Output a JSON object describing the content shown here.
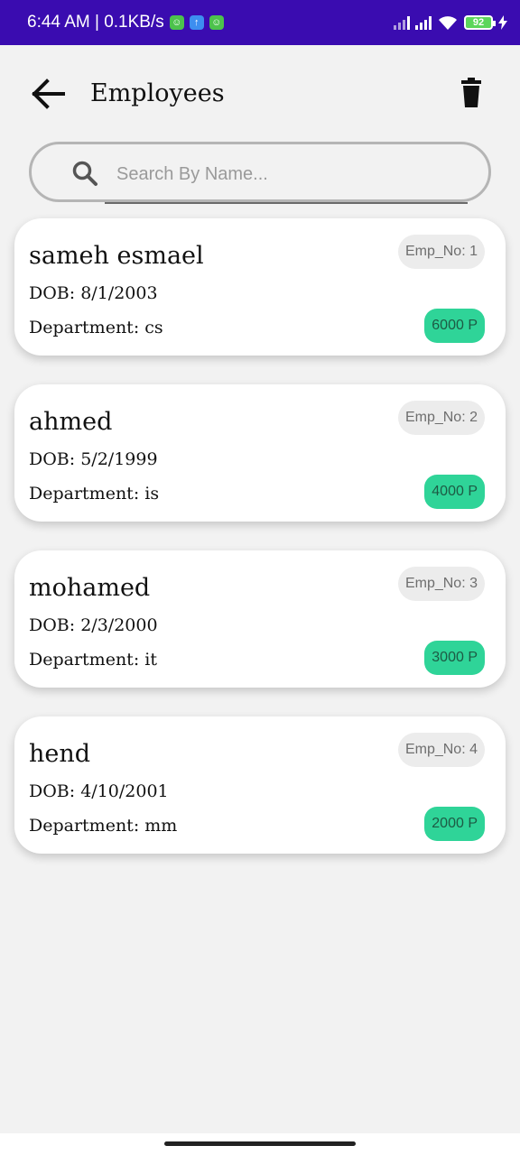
{
  "status_bar": {
    "time_speed": "6:44 AM | 0.1KB/s",
    "battery": "92"
  },
  "app_bar": {
    "title": "Employees"
  },
  "search": {
    "placeholder": "Search By Name..."
  },
  "employees": [
    {
      "name": "sameh esmael",
      "dob": "DOB: 8/1/2003",
      "department": "Department: cs",
      "emp_no": "Emp_No: 1",
      "salary": "6000 P"
    },
    {
      "name": "ahmed",
      "dob": "DOB: 5/2/1999",
      "department": "Department: is",
      "emp_no": "Emp_No: 2",
      "salary": "4000 P"
    },
    {
      "name": "mohamed",
      "dob": "DOB: 2/3/2000",
      "department": "Department: it",
      "emp_no": "Emp_No: 3",
      "salary": "3000 P"
    },
    {
      "name": "hend",
      "dob": "DOB: 4/10/2001",
      "department": "Department: mm",
      "emp_no": "Emp_No: 4",
      "salary": "2000 P"
    }
  ],
  "colors": {
    "status_bar": "#3a0cb0",
    "salary_badge": "#2fd498",
    "background": "#f2f2f2"
  }
}
